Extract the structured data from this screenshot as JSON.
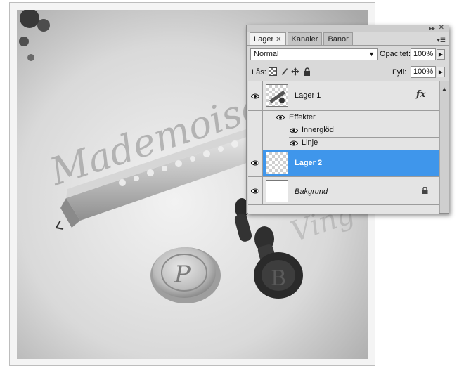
{
  "photo": {
    "script_text": "Mademoiselle",
    "script_text_right": "Ving"
  },
  "panel": {
    "collapse_glyph": "▸▸",
    "close_glyph": "✕",
    "menu_glyph": "▾☰",
    "tabs": [
      {
        "label": "Lager",
        "active": true,
        "close": "✕"
      },
      {
        "label": "Kanaler",
        "active": false
      },
      {
        "label": "Banor",
        "active": false
      }
    ],
    "blend_mode": "Normal",
    "dropdown_glyph": "▼",
    "opacity_label": "Opacitet:",
    "opacity_value": "100%",
    "spin_glyph": "▶",
    "lock_label": "Lås:",
    "fill_label": "Fyll:",
    "fill_value": "100%",
    "layers": {
      "lager1": {
        "name": "Lager 1",
        "fx": "fx"
      },
      "effekter": {
        "name": "Effekter"
      },
      "innerglod": {
        "name": "Innerglöd"
      },
      "linje": {
        "name": "Linje"
      },
      "lager2": {
        "name": "Lager 2",
        "selected": true
      },
      "bakgrund": {
        "name": "Bakgrund",
        "locked": true
      }
    },
    "scroll_up_glyph": "▲",
    "colors": {
      "selection": "#3f96eb",
      "panel_bg": "#d9d9d9"
    }
  }
}
